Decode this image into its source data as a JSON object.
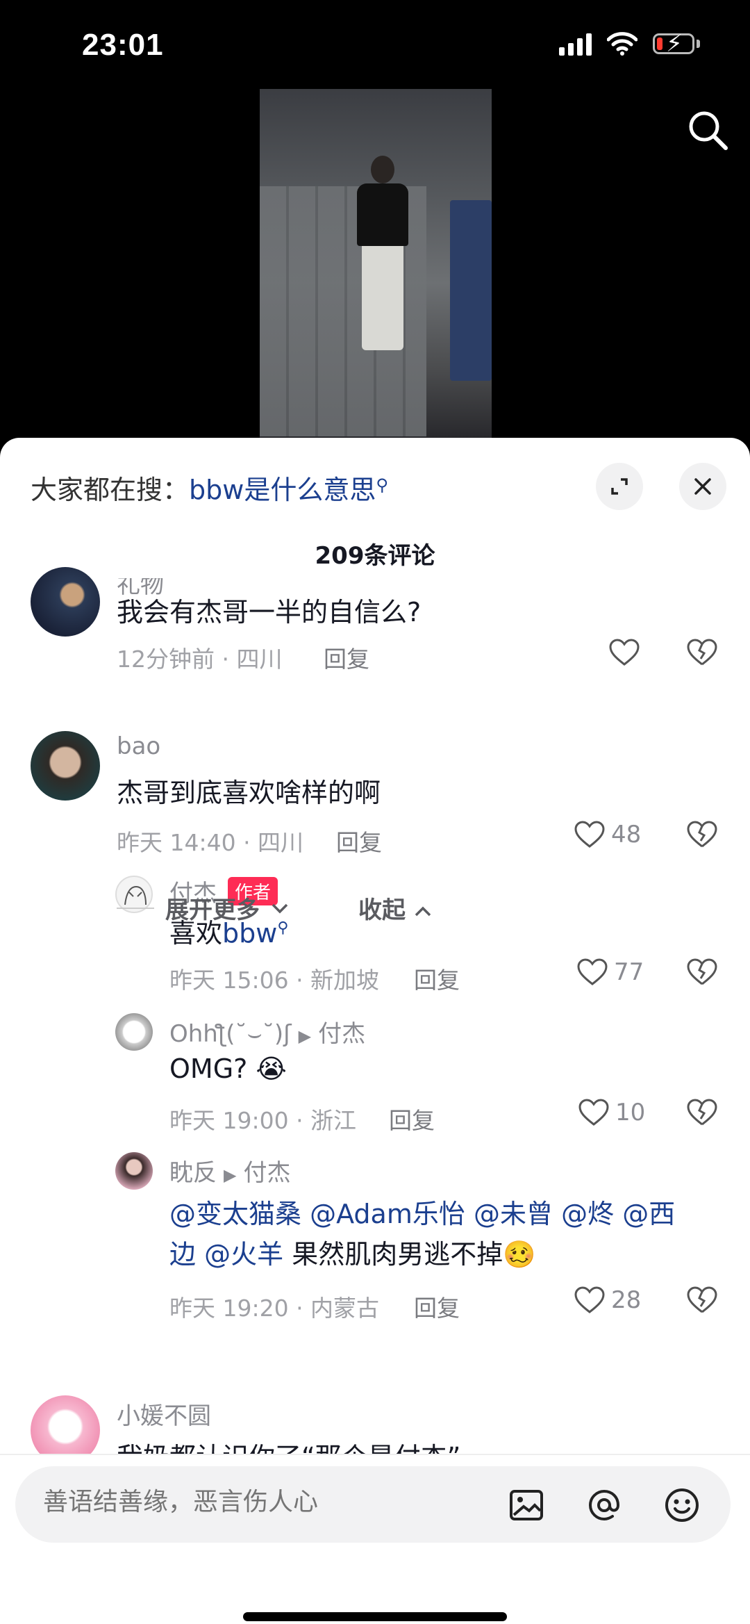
{
  "status": {
    "time": "23:01"
  },
  "panel": {
    "hot_label": "大家都在搜：",
    "hot_keyword": "bbw是什么意思",
    "count": "209条评论"
  },
  "comments": [
    {
      "user": "礼物",
      "text": "我会有杰哥一半的自信么?",
      "time": "12分钟前 · 四川",
      "reply": "回复",
      "likes": ""
    },
    {
      "user": "bao",
      "text": "杰哥到底喜欢啥样的啊",
      "time": "昨天 14:40 · 四川",
      "reply": "回复",
      "likes": "48"
    },
    {
      "user": "付杰",
      "tag": "作者",
      "text": "喜欢",
      "keyword": "bbw",
      "time": "昨天 15:06 · 新加坡",
      "reply": "回复",
      "likes": "77"
    },
    {
      "user": "Ohhƪ(˘⌣˘)ʃ",
      "to": "付杰",
      "text": "OMG?",
      "emoji": "😭",
      "time": "昨天 19:00 · 浙江",
      "reply": "回复",
      "likes": "10"
    },
    {
      "user": "眈反",
      "to": "付杰",
      "line1": [
        "@变太猫桑",
        "@Adam乐怡",
        "@未曾",
        "@炵",
        "@西"
      ],
      "line2_mentions": [
        "边",
        "@火羊"
      ],
      "line2_text": "果然肌肉男逃不掉",
      "emoji": "🥴",
      "time": "昨天 19:20 · 内蒙古",
      "reply": "回复",
      "likes": "28"
    },
    {
      "user": "小媛不圆",
      "text": "我奶都认识你了“那个是付杰”"
    }
  ],
  "expand": {
    "more": "展开更多",
    "collapse": "收起"
  },
  "input": {
    "placeholder": "善语结善缘，恶言伤人心"
  }
}
